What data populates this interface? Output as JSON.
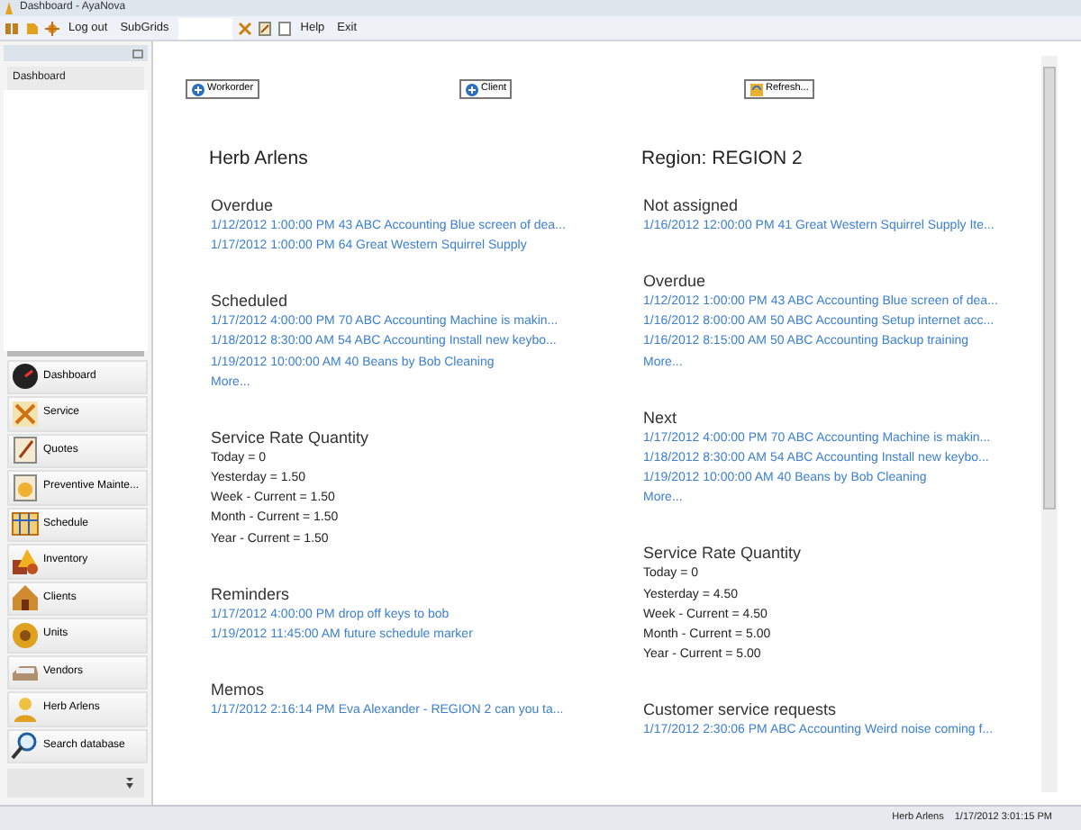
{
  "window": {
    "title": "Dashboard - AyaNova"
  },
  "toolbar": {
    "left_items": [
      "Log out",
      "SubGrids"
    ],
    "right_items": [
      "Help",
      "Exit"
    ]
  },
  "sidebar": {
    "panel_items": [
      {
        "label": "Dashboard"
      }
    ],
    "nav_items": [
      {
        "label": "Dashboard",
        "kind": "gauge"
      },
      {
        "label": "Service",
        "kind": "tools"
      },
      {
        "label": "Quotes",
        "kind": "document"
      },
      {
        "label": "Preventive Mainte...",
        "kind": "clock"
      },
      {
        "label": "Schedule",
        "kind": "calendar"
      },
      {
        "label": "Inventory",
        "kind": "boxes"
      },
      {
        "label": "Clients",
        "kind": "house"
      },
      {
        "label": "Units",
        "kind": "gear"
      },
      {
        "label": "Vendors",
        "kind": "tray"
      },
      {
        "label": "Herb Arlens",
        "kind": "person"
      },
      {
        "label": "Search database",
        "kind": "search"
      }
    ]
  },
  "buttons": [
    {
      "label": "Workorder",
      "kind": "add"
    },
    {
      "label": "Client",
      "kind": "add"
    },
    {
      "label": "Refresh...",
      "kind": "refresh"
    }
  ],
  "columns": [
    {
      "title": "Herb Arlens",
      "sections": [
        {
          "heading": "Overdue",
          "items": [
            {
              "text": "1/12/2012 1:00:00 PM 43 ABC Accounting Blue screen of dea...",
              "kind": "link"
            },
            {
              "text": "1/17/2012 1:00:00 PM 64 Great Western Squirrel Supply",
              "kind": "link"
            }
          ]
        },
        {
          "heading": "Scheduled",
          "items": [
            {
              "text": "1/17/2012 4:00:00 PM 70 ABC Accounting Machine is makin...",
              "kind": "link"
            },
            {
              "text": "1/18/2012 8:30:00 AM 54 ABC Accounting Install new keybo...",
              "kind": "link"
            },
            {
              "text": "1/19/2012 10:00:00 AM 40 Beans by Bob Cleaning",
              "kind": "link"
            },
            {
              "text": "More...",
              "kind": "link"
            }
          ]
        },
        {
          "heading": "Service Rate Quantity",
          "items": [
            {
              "text": "Today = 0",
              "kind": "text"
            },
            {
              "text": "Yesterday = 1.50",
              "kind": "text"
            },
            {
              "text": "Week - Current = 1.50",
              "kind": "text"
            },
            {
              "text": "Month - Current = 1.50",
              "kind": "text"
            },
            {
              "text": "Year - Current = 1.50",
              "kind": "text"
            }
          ]
        },
        {
          "heading": "Reminders",
          "items": [
            {
              "text": "1/17/2012 4:00:00 PM drop off keys to bob",
              "kind": "link"
            },
            {
              "text": "1/19/2012 11:45:00 AM future schedule marker",
              "kind": "link"
            }
          ]
        },
        {
          "heading": "Memos",
          "items": [
            {
              "text": "1/17/2012 2:16:14 PM Eva Alexander - REGION 2 can you ta...",
              "kind": "link"
            }
          ]
        }
      ]
    },
    {
      "title": "Region: REGION 2",
      "sections": [
        {
          "heading": "Not assigned",
          "items": [
            {
              "text": "1/16/2012 12:00:00 PM 41 Great Western Squirrel Supply Ite...",
              "kind": "link"
            }
          ]
        },
        {
          "heading": "Overdue",
          "items": [
            {
              "text": "1/12/2012 1:00:00 PM 43 ABC Accounting Blue screen of dea...",
              "kind": "link"
            },
            {
              "text": "1/16/2012 8:00:00 AM 50 ABC Accounting Setup internet acc...",
              "kind": "link"
            },
            {
              "text": "1/16/2012 8:15:00 AM 50 ABC Accounting Backup training",
              "kind": "link"
            },
            {
              "text": "More...",
              "kind": "link"
            }
          ]
        },
        {
          "heading": "Next",
          "items": [
            {
              "text": "1/17/2012 4:00:00 PM 70 ABC Accounting Machine is makin...",
              "kind": "link"
            },
            {
              "text": "1/18/2012 8:30:00 AM 54 ABC Accounting Install new keybo...",
              "kind": "link"
            },
            {
              "text": "1/19/2012 10:00:00 AM 40 Beans by Bob Cleaning",
              "kind": "link"
            },
            {
              "text": "More...",
              "kind": "link"
            }
          ]
        },
        {
          "heading": "Service Rate Quantity",
          "items": [
            {
              "text": "Today = 0",
              "kind": "text"
            },
            {
              "text": "Yesterday = 4.50",
              "kind": "text"
            },
            {
              "text": "Week - Current = 4.50",
              "kind": "text"
            },
            {
              "text": "Month - Current = 5.00",
              "kind": "text"
            },
            {
              "text": "Year - Current = 5.00",
              "kind": "text"
            }
          ]
        },
        {
          "heading": "Customer service requests",
          "items": [
            {
              "text": "1/17/2012 2:30:06 PM ABC Accounting Weird noise coming f...",
              "kind": "link"
            }
          ]
        }
      ]
    }
  ],
  "status_bar": {
    "user": "Herb Arlens",
    "timestamp": "1/17/2012 3:01:15 PM"
  }
}
